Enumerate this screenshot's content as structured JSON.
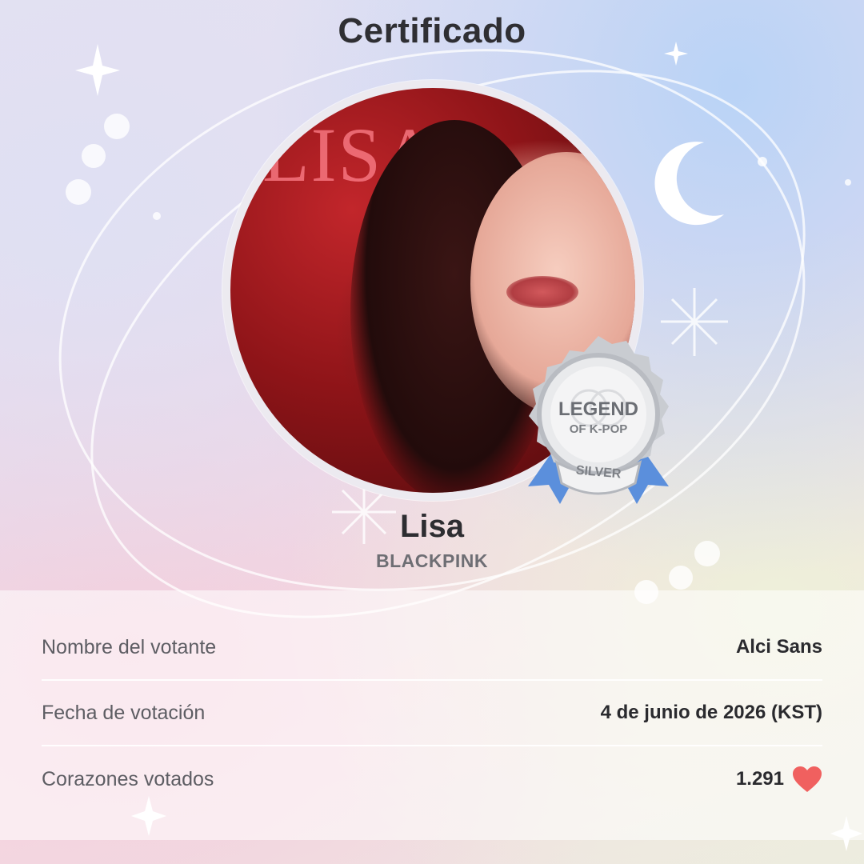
{
  "header": {
    "title": "Certificado"
  },
  "idol": {
    "photo_text": "LISA",
    "name": "Lisa",
    "group": "BLACKPINK"
  },
  "badge": {
    "line1": "LEGEND",
    "line2": "OF K-POP",
    "tier": "SILVER",
    "icon": "award-medal-icon",
    "ribbon_color": "#5b8fdc"
  },
  "details": [
    {
      "label": "Nombre del votante",
      "value": "Alci Sans"
    },
    {
      "label": "Fecha de votación",
      "value": "4 de junio de 2026 (KST)"
    },
    {
      "label": "Corazones votados",
      "value": "1.291",
      "icon": "heart-icon",
      "icon_color": "#f0605f"
    }
  ],
  "colors": {
    "title": "#2f2f33",
    "label": "#5d5d63",
    "value": "#2a2a2e",
    "group": "#6e6e74"
  }
}
